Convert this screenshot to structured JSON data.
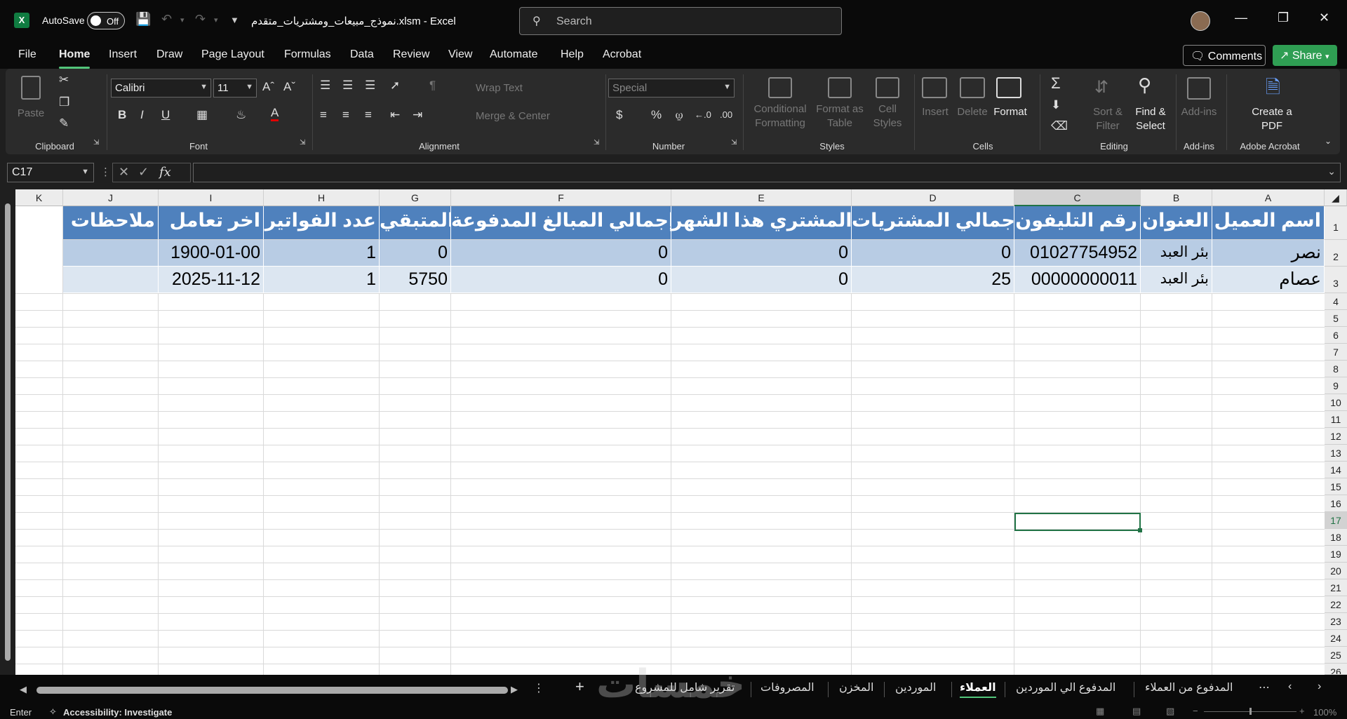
{
  "titlebar": {
    "app_icon": "X",
    "autosave_label": "AutoSave",
    "autosave_state": "Off",
    "doc_title": "نموذج_مبيعات_ومشتريات_متقدم.xlsm  -  Excel",
    "search_placeholder": "Search"
  },
  "menu": {
    "items": [
      "File",
      "Home",
      "Insert",
      "Draw",
      "Page Layout",
      "Formulas",
      "Data",
      "Review",
      "View",
      "Automate",
      "Help",
      "Acrobat"
    ],
    "active": "Home",
    "comments": "Comments",
    "share": "Share"
  },
  "ribbon": {
    "groups": [
      "Clipboard",
      "Font",
      "Alignment",
      "Number",
      "Styles",
      "Cells",
      "Editing",
      "Add-ins",
      "Adobe Acrobat"
    ],
    "paste": "Paste",
    "font_name": "Calibri",
    "font_size": "11",
    "wrap_text": "Wrap Text",
    "merge_center": "Merge & Center",
    "number_format": "Special",
    "conditional_formatting": "Conditional Formatting",
    "format_as_table": "Format as Table",
    "cell_styles": "Cell Styles",
    "insert": "Insert",
    "delete": "Delete",
    "format": "Format",
    "sort_filter": "Sort & Filter",
    "find_select": "Find & Select",
    "add_ins": "Add-ins",
    "create_pdf": "Create a PDF"
  },
  "formula_bar": {
    "name_box": "C17",
    "formula": ""
  },
  "columns": [
    "K",
    "J",
    "I",
    "H",
    "G",
    "F",
    "E",
    "D",
    "C",
    "B",
    "A"
  ],
  "rows": [
    "1",
    "2",
    "3",
    "4",
    "5",
    "6",
    "7",
    "8",
    "9",
    "10",
    "11",
    "12",
    "13",
    "14",
    "15",
    "16",
    "17",
    "18",
    "19",
    "20",
    "21",
    "22",
    "23",
    "24",
    "25",
    "26"
  ],
  "selected_cell": {
    "column": "C",
    "row": "17"
  },
  "table": {
    "headers": {
      "A": "اسم العميل",
      "B": "العنوان",
      "C": "رقم التليفون",
      "D": "إجمالي المشتريات",
      "E": "المشتري هذا الشهر",
      "F": "إجمالي المبالغ المدفوعة",
      "G": "المتبقي",
      "H": "عدد الفواتير",
      "I": "اخر تعامل",
      "J": "ملاحظات"
    },
    "rows": [
      {
        "A": "نصر",
        "B": "بئر العبد",
        "C": "01027754952",
        "D": "0",
        "E": "0",
        "F": "0",
        "G": "0",
        "H": "1",
        "I": "1900-01-00",
        "J": ""
      },
      {
        "A": "عصام",
        "B": "بئر العبد",
        "C": "00000000011",
        "D": "25",
        "E": "0",
        "F": "0",
        "G": "5750",
        "H": "1",
        "I": "2025-11-12",
        "J": ""
      }
    ],
    "header_color": "#4F81BD",
    "band_color_1": "#B8CCE4",
    "band_color_2": "#DCE6F1"
  },
  "sheet_tabs": [
    "تقرير شامل للمشروع",
    "المصروفات",
    "المخزن",
    "الموردين",
    "العملاء",
    "المدفوع الي الموردين",
    "المدفوع من العملاء"
  ],
  "active_tab": "العملاء",
  "status": {
    "mode": "Enter",
    "accessibility": "Accessibility: Investigate",
    "zoom": "100%"
  },
  "watermark": "خمسات"
}
